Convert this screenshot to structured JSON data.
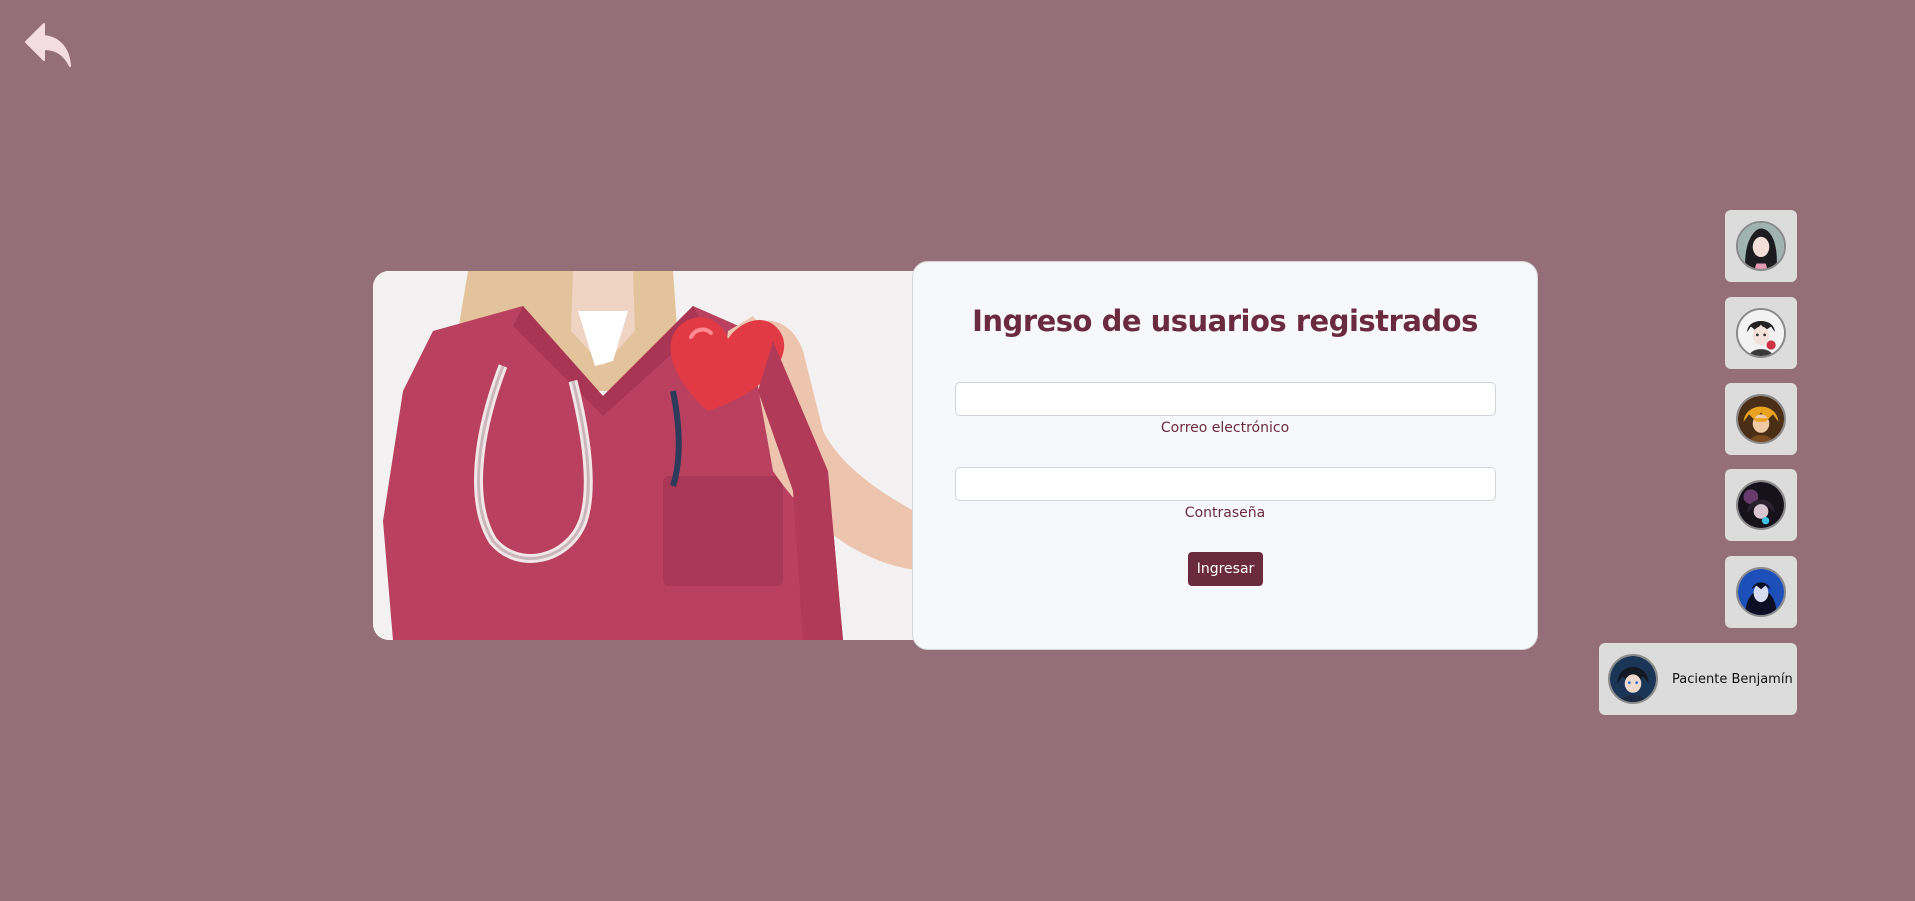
{
  "nav": {
    "back_icon": "reply-arrow-icon"
  },
  "hero": {
    "image_subject": "nurse-holding-heart-photo"
  },
  "login": {
    "title": "Ingreso de usuarios registrados",
    "email_label": "Correo electrónico",
    "email_value": "",
    "password_label": "Contraseña",
    "password_value": "",
    "submit_label": "Ingresar"
  },
  "user_switcher": {
    "users": [
      {
        "avatar": "avatar-1",
        "name": ""
      },
      {
        "avatar": "avatar-2",
        "name": ""
      },
      {
        "avatar": "avatar-3",
        "name": ""
      },
      {
        "avatar": "avatar-4",
        "name": ""
      },
      {
        "avatar": "avatar-5",
        "name": ""
      },
      {
        "avatar": "avatar-6",
        "name": "Paciente Benjamín"
      }
    ]
  },
  "colors": {
    "background": "#946f78",
    "accent": "#6b2b3e",
    "card": "#f7f8fa",
    "tile": "#dcdcdc"
  }
}
